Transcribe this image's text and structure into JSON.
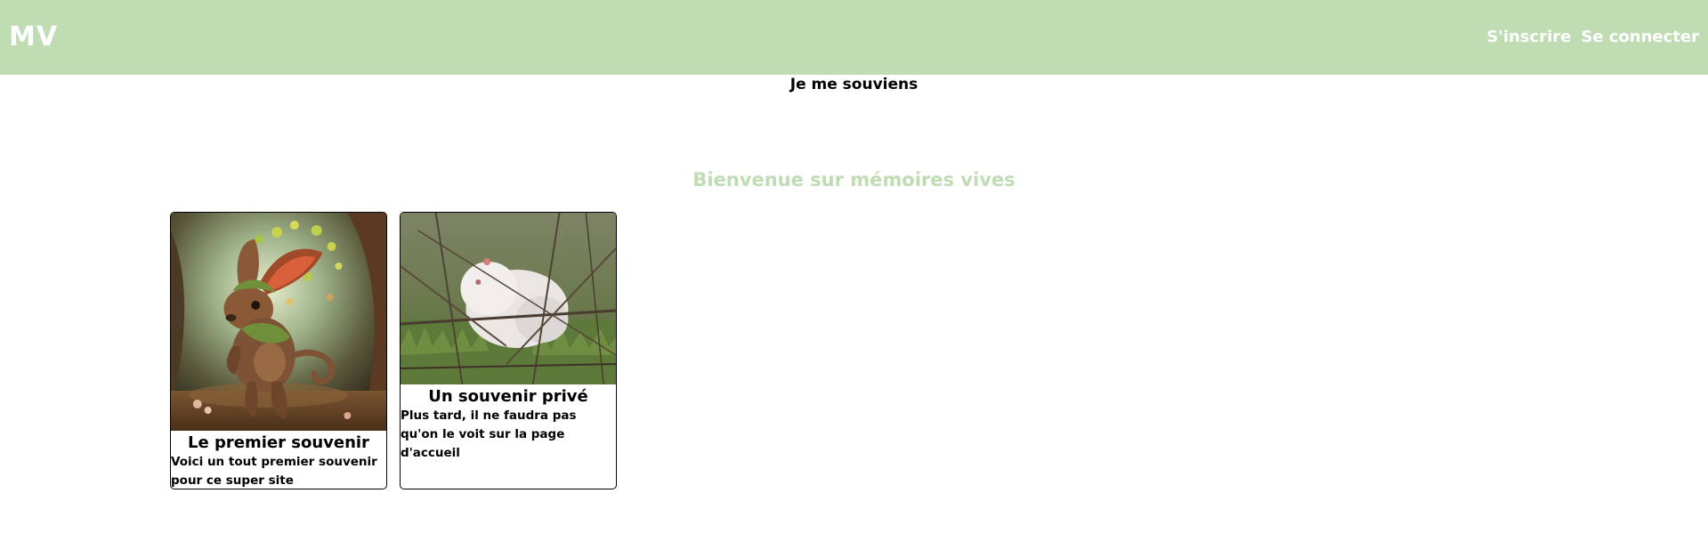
{
  "header": {
    "logo": "MV",
    "nav": {
      "signup": "S'inscrire",
      "login": "Se connecter"
    },
    "colors": {
      "background": "#bfdcb3",
      "text": "#ffffff"
    }
  },
  "page": {
    "subtitle": "Je me souviens",
    "welcome": "Bienvenue sur mémoires vives"
  },
  "cards": [
    {
      "image": "fantasy-rabbit-creature-image",
      "title": "Le premier souvenir",
      "description": "Voici un tout premier souvenir pour ce super site"
    },
    {
      "image": "white-animal-in-brush-image",
      "title": "Un souvenir privé",
      "description": "Plus tard, il ne faudra pas qu'on le voit sur la page d'accueil"
    }
  ]
}
